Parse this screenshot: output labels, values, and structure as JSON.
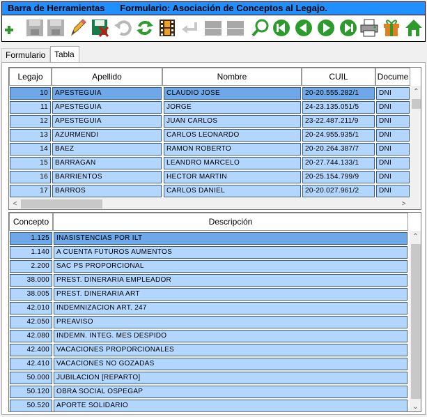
{
  "title": {
    "left": "Barra de Herramientas",
    "right": "Formulario: Asociación de Conceptos al Legajo."
  },
  "toolbar": {
    "buttons": [
      {
        "name": "add",
        "icon": "plus-icon",
        "enabled": true
      },
      {
        "name": "save",
        "icon": "floppy-icon",
        "enabled": false
      },
      {
        "name": "save-as",
        "icon": "floppy-icon",
        "enabled": false
      },
      {
        "name": "edit",
        "icon": "pencil-icon",
        "enabled": true
      },
      {
        "name": "delete",
        "icon": "floppy-delete-icon",
        "enabled": true
      },
      {
        "name": "undo",
        "icon": "undo-icon",
        "enabled": false
      },
      {
        "name": "refresh",
        "icon": "refresh-icon",
        "enabled": true
      },
      {
        "name": "film",
        "icon": "film-icon",
        "enabled": true
      },
      {
        "name": "back",
        "icon": "return-icon",
        "enabled": false
      },
      {
        "name": "disabled-1",
        "icon": "blank-icon",
        "enabled": false
      },
      {
        "name": "disabled-2",
        "icon": "blank-icon",
        "enabled": false
      },
      {
        "name": "search",
        "icon": "magnifier-icon",
        "enabled": true
      },
      {
        "name": "first",
        "icon": "first-icon",
        "enabled": true
      },
      {
        "name": "prev",
        "icon": "prev-icon",
        "enabled": true
      },
      {
        "name": "next",
        "icon": "next-icon",
        "enabled": true
      },
      {
        "name": "last",
        "icon": "last-icon",
        "enabled": true
      },
      {
        "name": "print",
        "icon": "printer-icon",
        "enabled": true
      },
      {
        "name": "gift",
        "icon": "gift-icon",
        "enabled": true
      },
      {
        "name": "home",
        "icon": "home-icon",
        "enabled": true
      }
    ]
  },
  "tabs": [
    {
      "label": "Formulario"
    },
    {
      "label": "Tabla"
    }
  ],
  "legajos": {
    "headers": [
      "Legajo",
      "Apellido",
      "Nombre",
      "CUIL",
      "Docume"
    ],
    "rows": [
      [
        "10",
        "APESTEGUIA",
        "CLAUDIO JOSE",
        "20-20.555.282/1",
        "DNI"
      ],
      [
        "11",
        "APESTEGUIA",
        "JORGE",
        "24-23.135.051/5",
        "DNI"
      ],
      [
        "12",
        "APESTEGUIA",
        "JUAN CARLOS",
        "23-22.487.211/9",
        "DNI"
      ],
      [
        "13",
        "AZURMENDI",
        "CARLOS LEONARDO",
        "20-24.955.935/1",
        "DNI"
      ],
      [
        "14",
        "BAEZ",
        "RAMON ROBERTO",
        "20-20.264.387/7",
        "DNI"
      ],
      [
        "15",
        "BARRAGAN",
        "LEANDRO MARCELO",
        "20-27.744.133/1",
        "DNI"
      ],
      [
        "16",
        "BARRIENTOS",
        "HECTOR MARTIN",
        "20-25.154.799/9",
        "DNI"
      ],
      [
        "17",
        "BARROS",
        "CARLOS DANIEL",
        "20-20.027.961/2",
        "DNI"
      ]
    ]
  },
  "conceptos": {
    "headers": [
      "Concepto",
      "Descripción"
    ],
    "rows": [
      [
        "1.125",
        "INASISTENCIAS POR ILT"
      ],
      [
        "1.140",
        "A CUENTA FUTUROS AUMENTOS"
      ],
      [
        "2.200",
        "SAC PS PROPORCIONAL"
      ],
      [
        "38.000",
        "PREST. DINERARIA EMPLEADOR"
      ],
      [
        "38.005",
        "PREST. DINERARIA ART"
      ],
      [
        "42.010",
        "INDEMNIZACION ART. 247"
      ],
      [
        "42.050",
        "PREAVISO"
      ],
      [
        "42.080",
        "INDEMN. INTEG. MES DESPIDO"
      ],
      [
        "42.400",
        "VACACIONES PROPORCIONALES"
      ],
      [
        "42.410",
        "VACACIONES NO GOZADAS"
      ],
      [
        "50.000",
        "JUBILACION [REPARTO]"
      ],
      [
        "50.120",
        "OBRA SOCIAL OSPEGAP"
      ],
      [
        "50.520",
        "APORTE SOLIDARIO"
      ]
    ]
  },
  "colors": {
    "titlebar": "#1e90ff",
    "cell": "#b3d6ff",
    "selected": "#6ea8e8"
  }
}
